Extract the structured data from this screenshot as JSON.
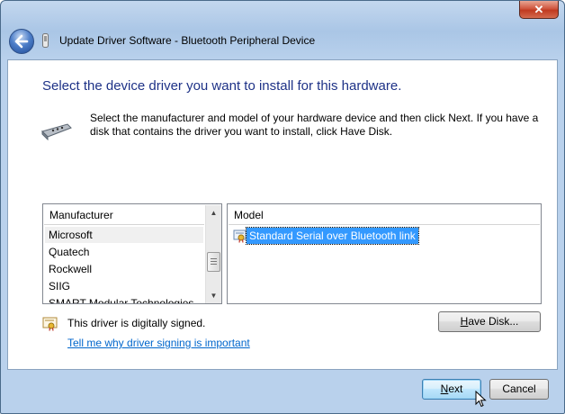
{
  "window": {
    "title": "Update Driver Software - Bluetooth Peripheral Device",
    "close_label": "✕"
  },
  "page": {
    "heading": "Select the device driver you want to install for this hardware.",
    "description": "Select the manufacturer and model of your hardware device and then click Next. If you have a disk that contains the driver you want to install, click Have Disk."
  },
  "manufacturer_list": {
    "header": "Manufacturer",
    "items": [
      "Microsoft",
      "Quatech",
      "Rockwell",
      "SIIG",
      "SMART Modular Technologies"
    ],
    "selected": "Microsoft"
  },
  "model_list": {
    "header": "Model",
    "items": [
      "Standard Serial over Bluetooth link"
    ],
    "selected": "Standard Serial over Bluetooth link"
  },
  "signing": {
    "status": "This driver is digitally signed.",
    "link": "Tell me why driver signing is important"
  },
  "buttons": {
    "have_disk_prefix": "H",
    "have_disk_rest": "ave Disk...",
    "next_prefix": "N",
    "next_rest": "ext",
    "cancel": "Cancel"
  },
  "colors": {
    "heading": "#1e3287",
    "link": "#0066cc",
    "selection": "#3399ff",
    "close": "#c03a20"
  }
}
